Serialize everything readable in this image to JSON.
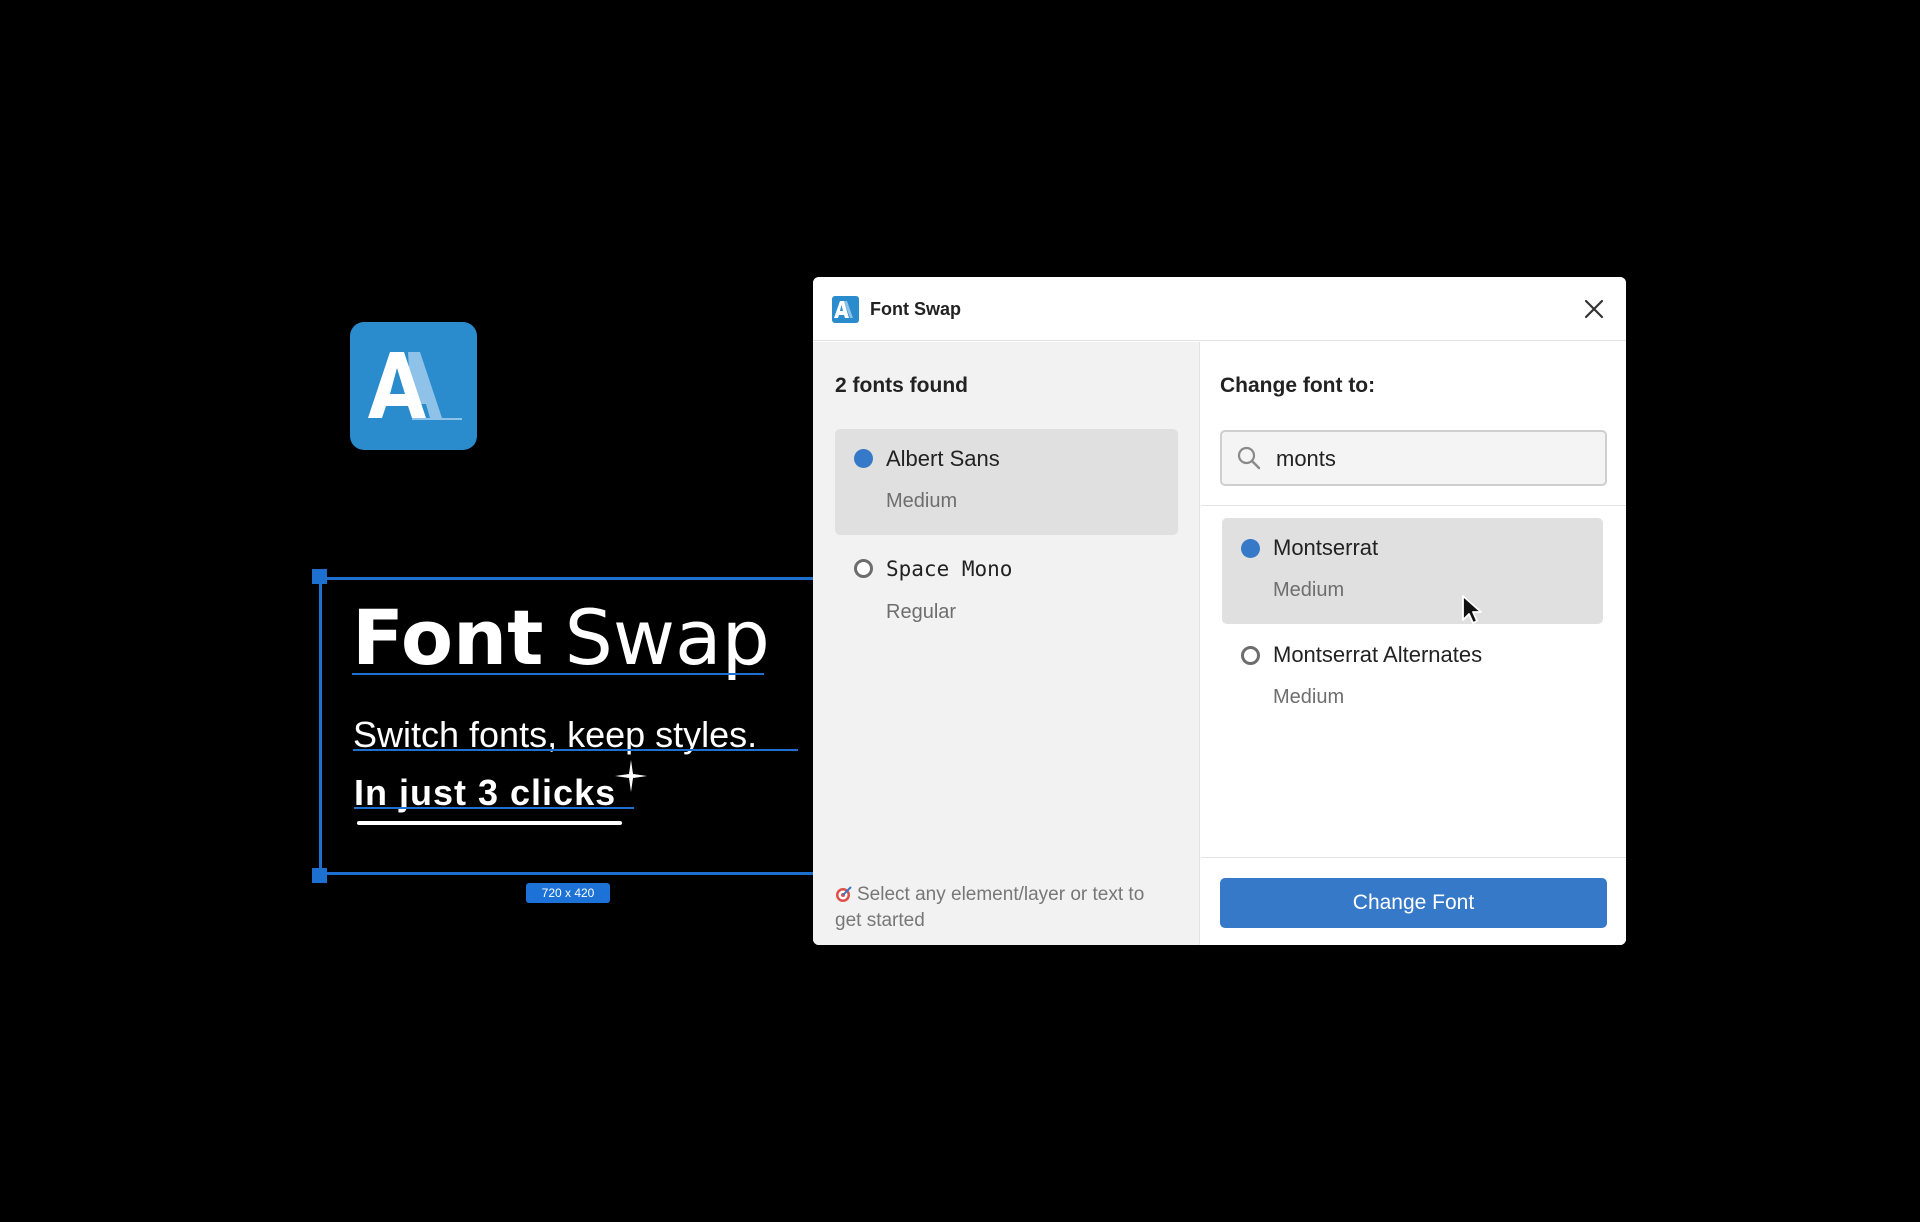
{
  "hero": {
    "title_bold": "Font",
    "title_regular": "Swap",
    "subtitle": "Switch fonts, keep styles.",
    "cta": "In just 3 clicks",
    "frame_size_badge": "720 x 420"
  },
  "window": {
    "title": "Font Swap",
    "logo_icon": "font-swap-logo-icon",
    "close_icon": "close-icon"
  },
  "left": {
    "found_label": "2 fonts found",
    "fonts": [
      {
        "name": "Albert Sans",
        "style": "Medium",
        "selected": true
      },
      {
        "name": "Space Mono",
        "style": "Regular",
        "selected": false
      }
    ],
    "hint": "Select any element/layer or text to get started"
  },
  "right": {
    "change_label": "Change font to:",
    "search_value": "monts",
    "results": [
      {
        "name": "Montserrat",
        "style": "Medium",
        "selected": true
      },
      {
        "name": "Montserrat Alternates",
        "style": "Medium",
        "selected": false
      }
    ],
    "button_label": "Change Font"
  },
  "colors": {
    "accent": "#3679c8",
    "brand": "#2a8ccc",
    "selection": "#1d6fd0",
    "background": "#000000"
  }
}
